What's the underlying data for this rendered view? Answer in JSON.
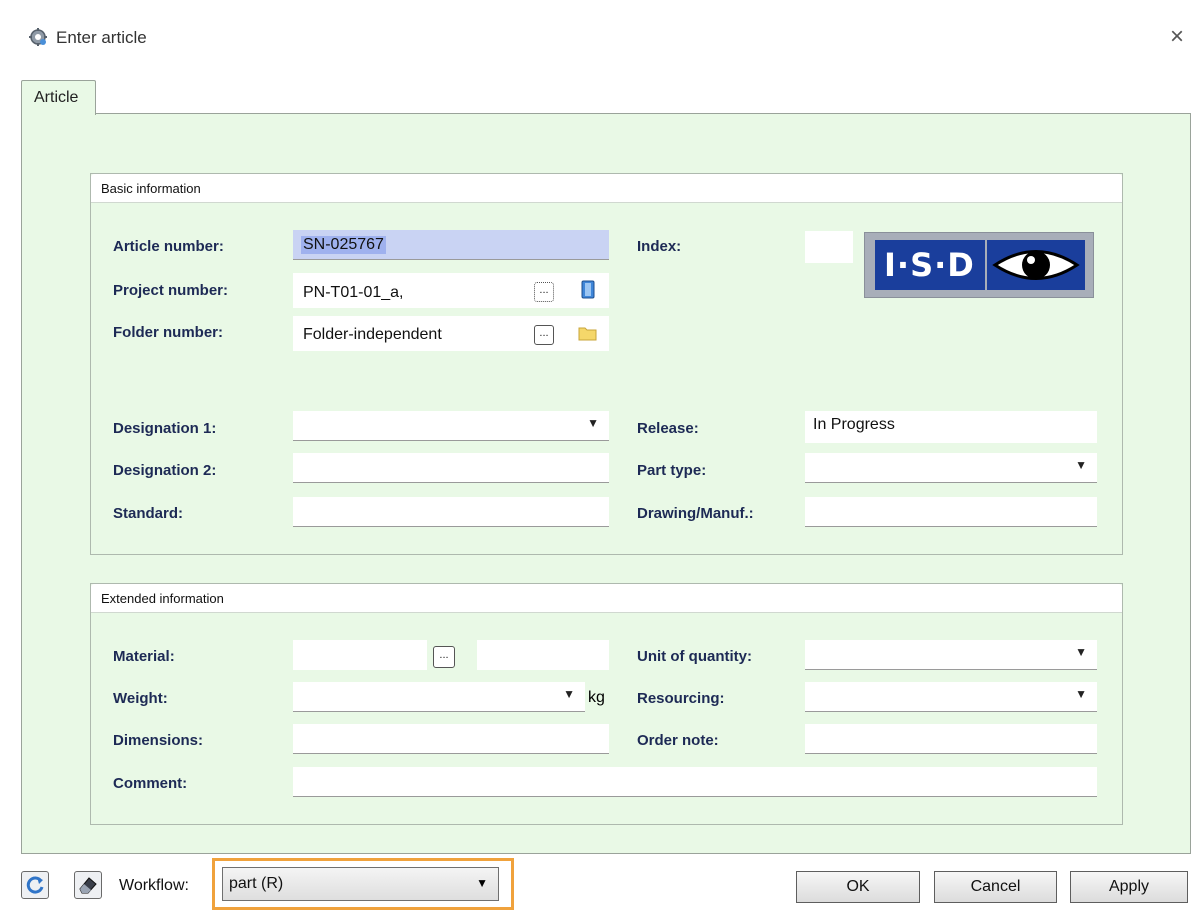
{
  "window": {
    "title": "Enter article",
    "close_glyph": "×"
  },
  "tab": {
    "label": "Article"
  },
  "basic": {
    "title": "Basic information",
    "article_number_label": "Article number:",
    "article_number_value": "SN-025767",
    "project_number_label": "Project number:",
    "project_number_value": "PN-T01-01_a,",
    "folder_number_label": "Folder number:",
    "folder_number_value": "Folder-independent",
    "index_label": "Index:",
    "index_value": "",
    "designation1_label": "Designation 1:",
    "designation1_value": "",
    "designation2_label": "Designation 2:",
    "designation2_value": "",
    "standard_label": "Standard:",
    "standard_value": "",
    "release_label": "Release:",
    "release_value": "In Progress",
    "part_type_label": "Part type:",
    "part_type_value": "",
    "drawing_label": "Drawing/Manuf.:",
    "drawing_value": "",
    "browse_dots": "...",
    "logo_text": "I·S·D"
  },
  "extended": {
    "title": "Extended information",
    "material_label": "Material:",
    "material_value1": "",
    "material_value2": "",
    "material_dots": "...",
    "weight_label": "Weight:",
    "weight_value": "",
    "weight_unit": "kg",
    "dimensions_label": "Dimensions:",
    "dimensions_value": "",
    "comment_label": "Comment:",
    "comment_value": "",
    "unit_label": "Unit of quantity:",
    "unit_value": "",
    "resourcing_label": "Resourcing:",
    "resourcing_value": "",
    "order_note_label": "Order note:",
    "order_note_value": ""
  },
  "footer": {
    "workflow_label": "Workflow:",
    "workflow_value": "part (R)",
    "ok_label": "OK",
    "cancel_label": "Cancel",
    "apply_label": "Apply"
  },
  "colors": {
    "panel_bg": "#e9f9e6",
    "label_text": "#1d2a55",
    "selection": "#9fb1ee",
    "workflow_highlight": "#f0a23c",
    "logo_blue": "#1a3e9c"
  },
  "icons": [
    "gear-icon",
    "close-icon",
    "book-icon",
    "folder-icon",
    "refresh-icon",
    "eraser-icon",
    "chevron-down-icon",
    "eye-icon"
  ]
}
